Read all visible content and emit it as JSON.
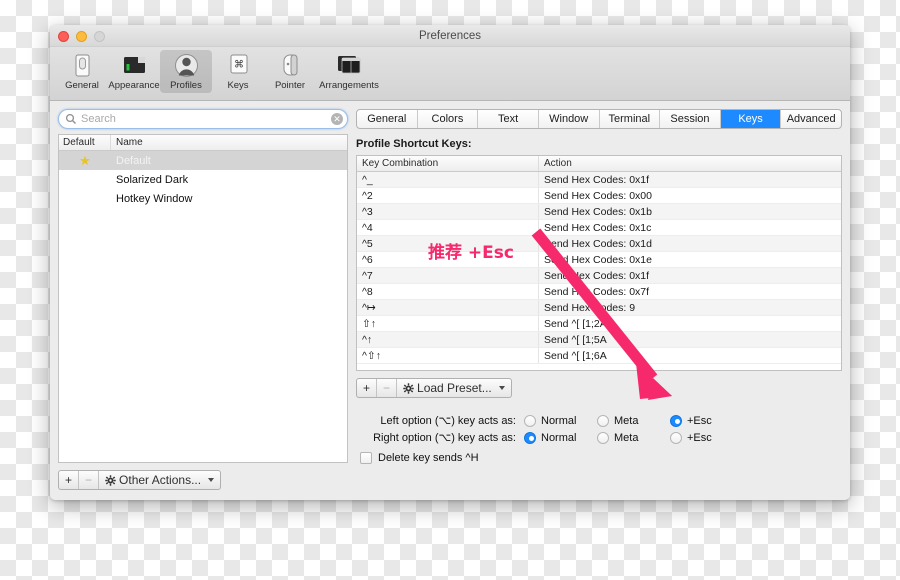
{
  "window": {
    "title": "Preferences",
    "traffic_lights": [
      "close",
      "minimize",
      "zoom"
    ]
  },
  "toolbar": {
    "items": [
      {
        "label": "General",
        "icon": "toggle-switch-icon",
        "selected": false
      },
      {
        "label": "Appearance",
        "icon": "window-appearance-icon",
        "selected": false
      },
      {
        "label": "Profiles",
        "icon": "user-silhouette-icon",
        "selected": true
      },
      {
        "label": "Keys",
        "icon": "command-key-icon",
        "selected": false
      },
      {
        "label": "Pointer",
        "icon": "mouse-icon",
        "selected": false
      },
      {
        "label": "Arrangements",
        "icon": "stacked-windows-icon",
        "selected": false
      }
    ]
  },
  "sidebar": {
    "search": {
      "placeholder": "Search",
      "value": "",
      "icon": "search-icon",
      "clear_icon": "clear-circle-icon"
    },
    "columns": [
      "Default",
      "Name"
    ],
    "profiles": [
      {
        "name": "Default",
        "is_default": true,
        "star": "★",
        "selected": true
      },
      {
        "name": "Solarized Dark",
        "is_default": false,
        "star": "",
        "selected": false
      },
      {
        "name": "Hotkey Window",
        "is_default": false,
        "star": "",
        "selected": false
      }
    ],
    "footer": {
      "add_label": "+",
      "remove_label": "−",
      "actions_label": "Other Actions...",
      "actions_icon": "gear-icon"
    }
  },
  "tabs": [
    {
      "label": "General",
      "selected": false
    },
    {
      "label": "Colors",
      "selected": false
    },
    {
      "label": "Text",
      "selected": false
    },
    {
      "label": "Window",
      "selected": false
    },
    {
      "label": "Terminal",
      "selected": false
    },
    {
      "label": "Session",
      "selected": false
    },
    {
      "label": "Keys",
      "selected": true
    },
    {
      "label": "Advanced",
      "selected": false
    }
  ],
  "keys_pane": {
    "section_title": "Profile Shortcut Keys:",
    "table": {
      "columns": [
        "Key Combination",
        "Action"
      ],
      "rows": [
        {
          "combo": "^_",
          "action": "Send Hex Codes: 0x1f"
        },
        {
          "combo": "^2",
          "action": "Send Hex Codes: 0x00"
        },
        {
          "combo": "^3",
          "action": "Send Hex Codes: 0x1b"
        },
        {
          "combo": "^4",
          "action": "Send Hex Codes: 0x1c"
        },
        {
          "combo": "^5",
          "action": "Send Hex Codes: 0x1d"
        },
        {
          "combo": "^6",
          "action": "Send Hex Codes: 0x1e"
        },
        {
          "combo": "^7",
          "action": "Send Hex Codes: 0x1f"
        },
        {
          "combo": "^8",
          "action": "Send Hex Codes: 0x7f"
        },
        {
          "combo": "^↦",
          "action": "Send Hex Codes: 9"
        },
        {
          "combo": "⇧↑",
          "action": "Send ^[ [1;2A"
        },
        {
          "combo": "^↑",
          "action": "Send ^[ [1;5A"
        },
        {
          "combo": "^⇧↑",
          "action": "Send ^[ [1;6A"
        }
      ]
    },
    "preset": {
      "add_label": "+",
      "remove_label": "−",
      "load_label": "Load Preset...",
      "gear_icon": "gear-icon"
    },
    "options": {
      "left_option_label": "Left option (⌥) key acts as:",
      "right_option_label": "Right option (⌥) key acts as:",
      "choices": [
        "Normal",
        "Meta",
        "+Esc"
      ],
      "left_selected": "+Esc",
      "right_selected": "Normal",
      "delete_key_label": "Delete key sends ^H",
      "delete_key_checked": false
    }
  },
  "annotation": {
    "text": "推荐 +Esc",
    "color": "#f5296b",
    "arrow_color": "#f5296b",
    "arrow_from": "annotation text near ^5/^6 rows",
    "arrow_to": "left option +Esc radio button"
  }
}
